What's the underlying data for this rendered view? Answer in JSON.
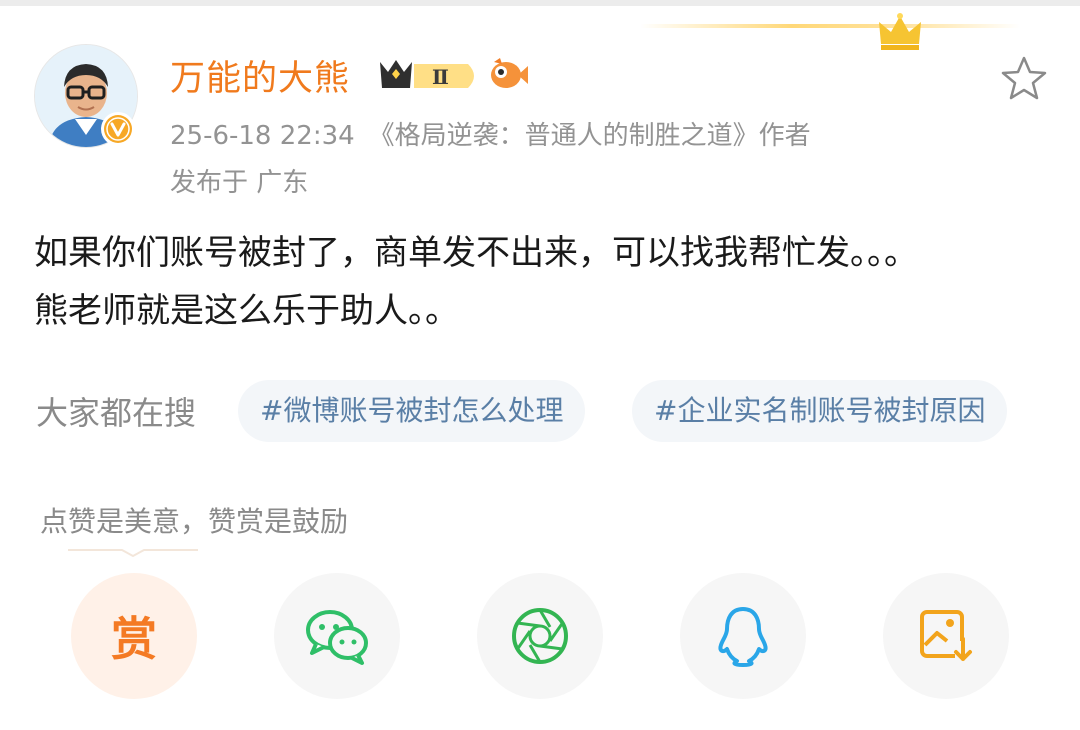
{
  "header": {
    "username": "万能的大熊",
    "vip_level": "Ⅱ",
    "timestamp": "25-6-18 22:34",
    "source": "《格局逆袭：普通人的制胜之道》作者",
    "location": "发布于 广东"
  },
  "post": {
    "lines": [
      "如果你们账号被封了，商单发不出来，可以找我帮忙发。。。",
      "熊老师就是这么乐于助人。。"
    ]
  },
  "search": {
    "label": "大家都在搜",
    "tags": [
      "#微博账号被封怎么处理",
      "#企业实名制账号被封原因"
    ]
  },
  "reward": {
    "hint": "点赞是美意，赞赏是鼓励",
    "button_glyph": "赏"
  },
  "share_buttons": [
    {
      "icon": "reward-icon"
    },
    {
      "icon": "wechat-icon"
    },
    {
      "icon": "moments-icon"
    },
    {
      "icon": "qq-icon"
    },
    {
      "icon": "save-image-icon"
    }
  ],
  "colors": {
    "username": "#f07a1d",
    "meta": "#939393",
    "tag_text": "#5a7fa6",
    "tag_bg": "#f3f6f9",
    "wechat": "#2fbf68",
    "moments": "#33b552",
    "qq": "#2aa6e8",
    "save": "#f2a41c",
    "reward": "#f47a24"
  }
}
